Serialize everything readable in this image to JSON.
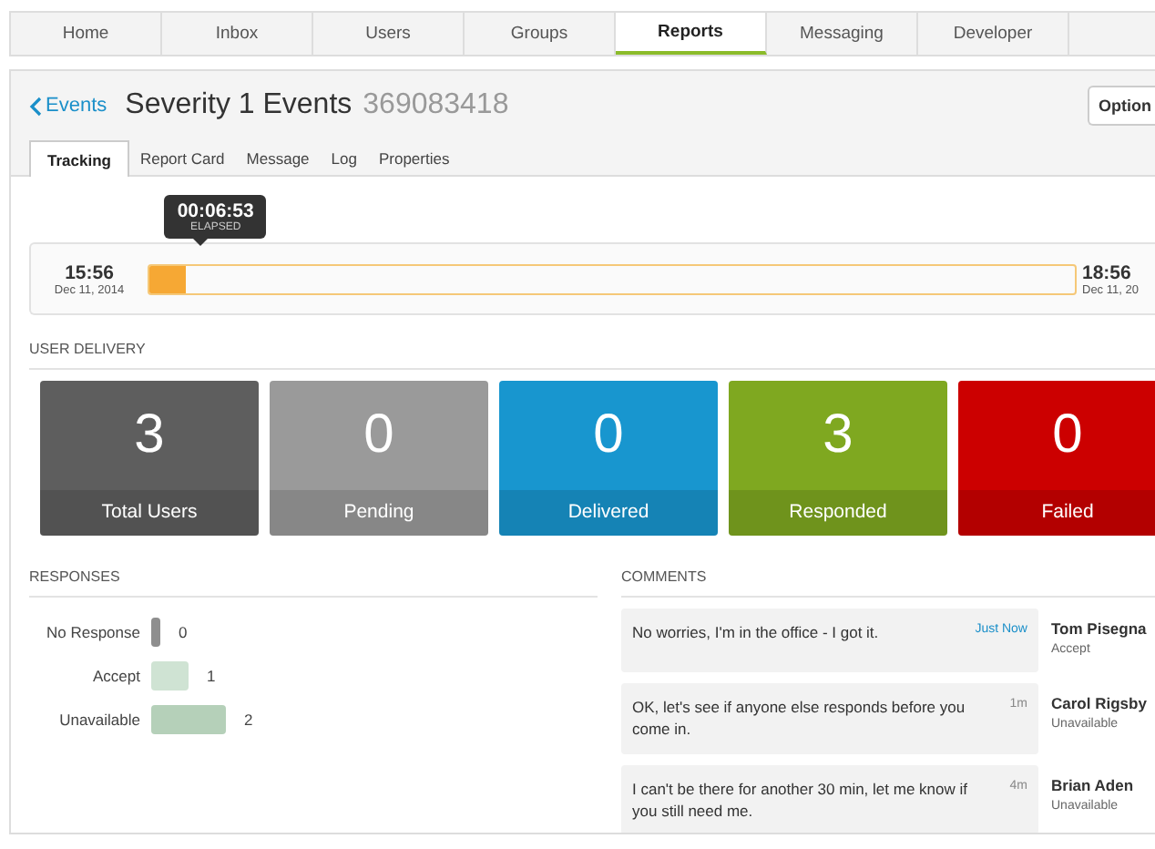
{
  "nav_tabs": [
    {
      "label": "Home",
      "selected": false
    },
    {
      "label": "Inbox",
      "selected": false
    },
    {
      "label": "Users",
      "selected": false
    },
    {
      "label": "Groups",
      "selected": false
    },
    {
      "label": "Reports",
      "selected": true
    },
    {
      "label": "Messaging",
      "selected": false
    },
    {
      "label": "Developer",
      "selected": false
    }
  ],
  "header": {
    "back_link": "Events",
    "title": "Severity 1 Events",
    "event_id": "369083418",
    "options_button": "Option"
  },
  "sub_tabs": [
    {
      "label": "Tracking",
      "selected": true
    },
    {
      "label": "Report Card",
      "selected": false
    },
    {
      "label": "Message",
      "selected": false
    },
    {
      "label": "Log",
      "selected": false
    },
    {
      "label": "Properties",
      "selected": false
    }
  ],
  "timeline": {
    "start_time": "15:56",
    "start_date": "Dec 11, 2014",
    "end_time": "18:56",
    "end_date": "Dec 11, 20",
    "level": 0.04,
    "elapsed": "00:06:53",
    "elapsed_label": "ELAPSED"
  },
  "user_delivery": {
    "heading": "USER DELIVERY",
    "cards": [
      {
        "count": "3",
        "label": "Total Users",
        "color": "#5e5e5e"
      },
      {
        "count": "0",
        "label": "Pending",
        "color": "#9a9a9a"
      },
      {
        "count": "0",
        "label": "Delivered",
        "color": "#1896cf"
      },
      {
        "count": "3",
        "label": "Responded",
        "color": "#7fa820"
      },
      {
        "count": "0",
        "label": "Failed",
        "color": "#cc0000"
      }
    ]
  },
  "responses": {
    "heading": "RESPONSES",
    "chart_data": {
      "type": "bar",
      "orientation": "horizontal",
      "categories": [
        "No Response",
        "Accept",
        "Unavailable"
      ],
      "values": [
        0,
        1,
        2
      ],
      "data_labels": true
    }
  },
  "comments": {
    "heading": "COMMENTS",
    "items": [
      {
        "text": "No worries, I'm in the office - I got it.",
        "time": "Just Now",
        "new": true,
        "name": "Tom Pisegna",
        "response": "Accept"
      },
      {
        "text": "OK, let's see if anyone else responds before you come in.",
        "time": "1m",
        "new": false,
        "name": "Carol Rigsby",
        "response": "Unavailable"
      },
      {
        "text": "I can't be there for another 30 min, let me know if you still need me.",
        "time": "4m",
        "new": false,
        "name": "Brian Aden",
        "response": "Unavailable"
      }
    ]
  }
}
